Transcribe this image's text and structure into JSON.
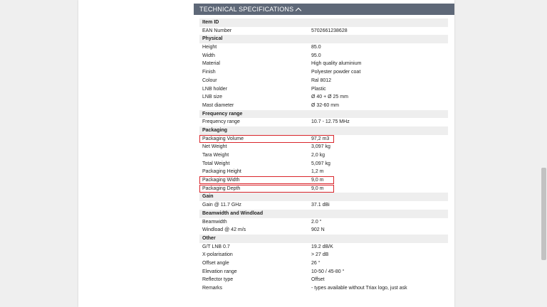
{
  "header": {
    "title": "TECHNICAL SPECIFICATIONS"
  },
  "sections": [
    {
      "title": "Item ID",
      "rows": [
        {
          "key": "EAN Number",
          "value": "5702661238628"
        }
      ]
    },
    {
      "title": "Physical",
      "rows": [
        {
          "key": "Height",
          "value": "85.0"
        },
        {
          "key": "Width",
          "value": "95.0"
        },
        {
          "key": "Material",
          "value": "High quality aluminium"
        },
        {
          "key": "Finish",
          "value": "Polyester powder coat"
        },
        {
          "key": "Colour",
          "value": "Ral 8012"
        },
        {
          "key": "LNB holder",
          "value": "Plastic"
        },
        {
          "key": "LNB size",
          "value": "Ø 40 + Ø 25 mm"
        },
        {
          "key": "Mast diameter",
          "value": "Ø 32-60 mm"
        }
      ]
    },
    {
      "title": "Frequency range",
      "rows": [
        {
          "key": "Frequency range",
          "value": "10.7 - 12.75 MHz"
        }
      ]
    },
    {
      "title": "Packaging",
      "rows": [
        {
          "key": "Packaging Volume",
          "value": "97,2 m3",
          "highlight": true
        },
        {
          "key": "Net Weight",
          "value": "3,097 kg"
        },
        {
          "key": "Tara Weight",
          "value": "2,0 kg"
        },
        {
          "key": "Total Weight",
          "value": "5,097 kg"
        },
        {
          "key": "Packaging Height",
          "value": "1,2 m"
        },
        {
          "key": "Packaging Width",
          "value": "9,0 m",
          "highlight": true
        },
        {
          "key": "Packaging Depth",
          "value": "9,0 m",
          "highlight": true
        }
      ]
    },
    {
      "title": "Gain",
      "rows": [
        {
          "key": "Gain @ 11.7 GHz",
          "value": "37.1 dBi"
        }
      ]
    },
    {
      "title": "Beamwidth and Windload",
      "rows": [
        {
          "key": "Beamwidth",
          "value": "2.0 °"
        },
        {
          "key": "Windload @ 42 m/s",
          "value": "902 N"
        }
      ]
    },
    {
      "title": "Other",
      "rows": [
        {
          "key": "G/T LNB 0.7",
          "value": "19.2 dB/K"
        },
        {
          "key": "X-polarisation",
          "value": "> 27 dB"
        },
        {
          "key": "Offset angle",
          "value": "26 °"
        },
        {
          "key": "Elevation range",
          "value": "10-50 / 45-80 °"
        },
        {
          "key": "Reflector type",
          "value": "Offset"
        },
        {
          "key": "Remarks",
          "value": "- types available without Triax logo, just ask"
        }
      ]
    }
  ],
  "colors": {
    "header_bg": "#5e6878",
    "section_bg": "#eeeeee",
    "highlight": "#d9262c"
  }
}
